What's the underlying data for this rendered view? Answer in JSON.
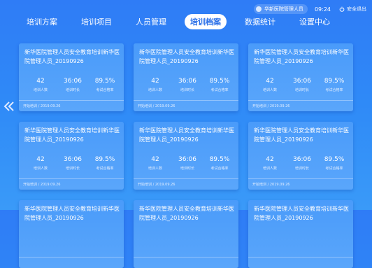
{
  "nav": {
    "tabs": [
      "培训方案",
      "培训项目",
      "人员管理",
      "培训档案",
      "数据统计",
      "设置中心"
    ],
    "active_index": 3
  },
  "header": {
    "user_name": "华新医院管理人员",
    "time": "09:24",
    "logout_label": "安全退出"
  },
  "cards": [
    {
      "title": "新华医院管理人员安全教育培训新华医院管理人员_20190926",
      "count": "42",
      "count_label": "培训人数",
      "hours": "36:06",
      "hours_label": "培训时长",
      "rate": "89.5%",
      "rate_label": "考试合格率",
      "footer": "开始培训 / 2019.09.26"
    },
    {
      "title": "新华医院管理人员安全教育培训新华医院管理人员_20190926",
      "count": "42",
      "count_label": "培训人数",
      "hours": "36:06",
      "hours_label": "培训时长",
      "rate": "89.5%",
      "rate_label": "考试合格率",
      "footer": "开始培训 / 2019.09.26"
    },
    {
      "title": "新华医院管理人员安全教育培训新华医院管理人员_20190926",
      "count": "42",
      "count_label": "培训人数",
      "hours": "36:06",
      "hours_label": "培训时长",
      "rate": "89.5%",
      "rate_label": "考试合格率",
      "footer": "开始培训 / 2019.09.26"
    },
    {
      "title": "新华医院管理人员安全教育培训新华医院管理人员_20190926",
      "count": "42",
      "count_label": "培训人数",
      "hours": "36:06",
      "hours_label": "培训时长",
      "rate": "89.5%",
      "rate_label": "考试合格率",
      "footer": "开始培训 / 2019.09.26"
    },
    {
      "title": "新华医院管理人员安全教育培训新华医院管理人员_20190926",
      "count": "42",
      "count_label": "培训人数",
      "hours": "36:06",
      "hours_label": "培训时长",
      "rate": "89.5%",
      "rate_label": "考试合格率",
      "footer": "开始培训 / 2019.09.26"
    },
    {
      "title": "新华医院管理人员安全教育培训新华医院管理人员_20190926",
      "count": "42",
      "count_label": "培训人数",
      "hours": "36:06",
      "hours_label": "培训时长",
      "rate": "89.5%",
      "rate_label": "考试合格率",
      "footer": "开始培训 / 2019.09.26"
    },
    {
      "title": "新华医院管理人员安全教育培训新华医院管理人员_20190926",
      "count": "",
      "count_label": "",
      "hours": "",
      "hours_label": "",
      "rate": "",
      "rate_label": "",
      "footer": ""
    },
    {
      "title": "新华医院管理人员安全教育培训新华医院管理人员_20190926",
      "count": "",
      "count_label": "",
      "hours": "",
      "hours_label": "",
      "rate": "",
      "rate_label": "",
      "footer": ""
    },
    {
      "title": "新华医院管理人员安全教育培训新华医院管理人员_20190926",
      "count": "",
      "count_label": "",
      "hours": "",
      "hours_label": "",
      "rate": "",
      "rate_label": "",
      "footer": ""
    }
  ],
  "icons": {
    "left_arrow": "chevron-double-left-icon",
    "logout": "power-icon"
  }
}
